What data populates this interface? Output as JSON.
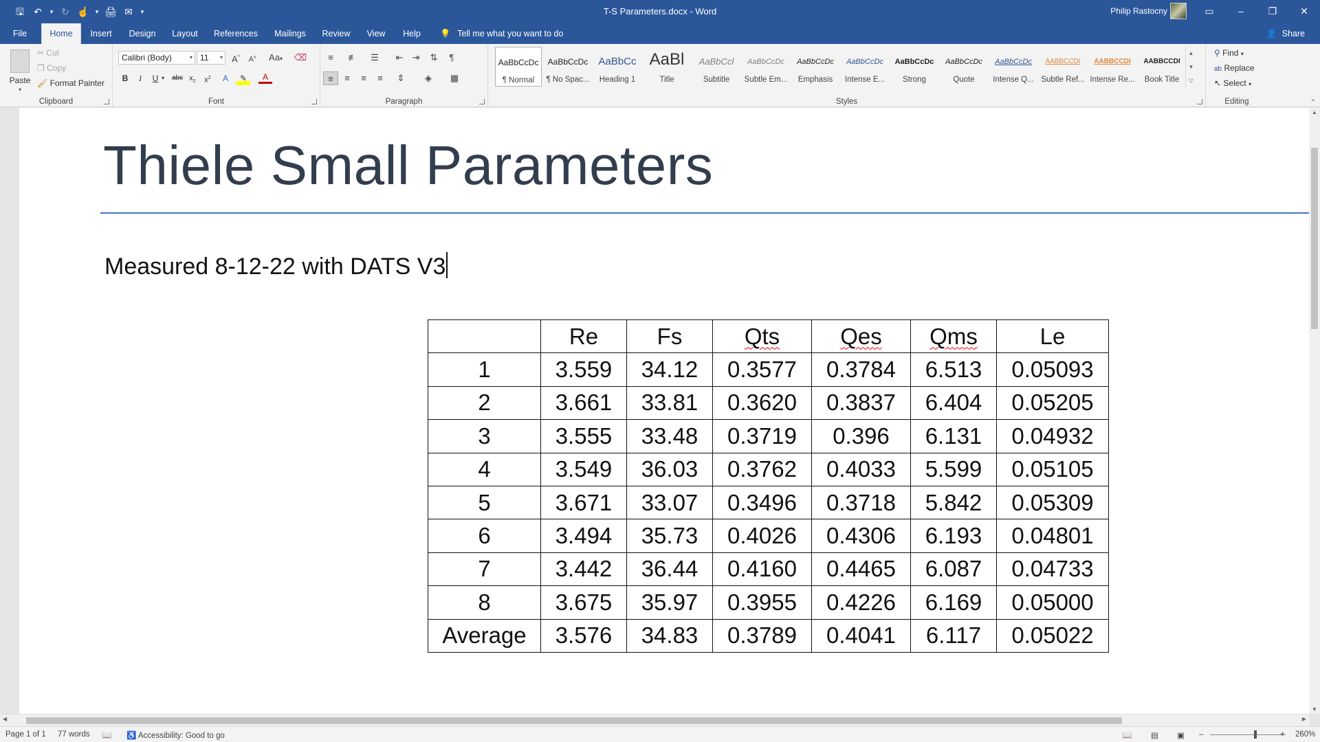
{
  "window": {
    "title": "T-S Parameters.docx  -  Word",
    "user_name": "Philip Rastocny",
    "controls": {
      "ribbon_display": "▭",
      "minimize": "–",
      "restore": "❐",
      "close": "✕"
    }
  },
  "quick_access": [
    "save-icon",
    "undo-icon",
    "redo-icon",
    "touch-mode-icon",
    "print-preview-icon",
    "email-icon",
    "customize-icon"
  ],
  "tabs": [
    "File",
    "Home",
    "Insert",
    "Design",
    "Layout",
    "References",
    "Mailings",
    "Review",
    "View",
    "Help"
  ],
  "active_tab": "Home",
  "tell_me": "Tell me what you want to do",
  "share": "Share",
  "ribbon": {
    "clipboard": {
      "label": "Clipboard",
      "paste": "Paste",
      "cut": "Cut",
      "copy": "Copy",
      "format_painter": "Format Painter"
    },
    "font": {
      "label": "Font",
      "font_name": "Calibri (Body)",
      "font_size": "11"
    },
    "paragraph": {
      "label": "Paragraph"
    },
    "styles": {
      "label": "Styles",
      "items": [
        {
          "preview": "AaBbCcDc",
          "name": "¶ Normal"
        },
        {
          "preview": "AaBbCcDc",
          "name": "¶ No Spac..."
        },
        {
          "preview": "AaBbCc",
          "name": "Heading 1"
        },
        {
          "preview": "AaBl",
          "name": "Title"
        },
        {
          "preview": "AaBbCcl",
          "name": "Subtitle"
        },
        {
          "preview": "AaBbCcDc",
          "name": "Subtle Em..."
        },
        {
          "preview": "AaBbCcDc",
          "name": "Emphasis"
        },
        {
          "preview": "AaBbCcDc",
          "name": "Intense E..."
        },
        {
          "preview": "AaBbCcDc",
          "name": "Strong"
        },
        {
          "preview": "AaBbCcDc",
          "name": "Quote"
        },
        {
          "preview": "AaBbCcDc",
          "name": "Intense Q..."
        },
        {
          "preview": "AABBCCDI",
          "name": "Subtle Ref..."
        },
        {
          "preview": "AABBCCDI",
          "name": "Intense Re..."
        },
        {
          "preview": "AABBCCDI",
          "name": "Book Title"
        }
      ]
    },
    "editing": {
      "label": "Editing",
      "find": "Find",
      "replace": "Replace",
      "select": "Select"
    }
  },
  "document": {
    "heading": "Thiele Small Parameters",
    "subtitle": "Measured 8-12-22 with DATS V3",
    "table": {
      "headers": [
        "",
        "Re",
        "Fs",
        "Qts",
        "Qes",
        "Qms",
        "Le"
      ],
      "rows": [
        [
          "1",
          "3.559",
          "34.12",
          "0.3577",
          "0.3784",
          "6.513",
          "0.05093"
        ],
        [
          "2",
          "3.661",
          "33.81",
          "0.3620",
          "0.3837",
          "6.404",
          "0.05205"
        ],
        [
          "3",
          "3.555",
          "33.48",
          "0.3719",
          "0.396",
          "6.131",
          "0.04932"
        ],
        [
          "4",
          "3.549",
          "36.03",
          "0.3762",
          "0.4033",
          "5.599",
          "0.05105"
        ],
        [
          "5",
          "3.671",
          "33.07",
          "0.3496",
          "0.3718",
          "5.842",
          "0.05309"
        ],
        [
          "6",
          "3.494",
          "35.73",
          "0.4026",
          "0.4306",
          "6.193",
          "0.04801"
        ],
        [
          "7",
          "3.442",
          "36.44",
          "0.4160",
          "0.4465",
          "6.087",
          "0.04733"
        ],
        [
          "8",
          "3.675",
          "35.97",
          "0.3955",
          "0.4226",
          "6.169",
          "0.05000"
        ],
        [
          "Average",
          "3.576",
          "34.83",
          "0.3789",
          "0.4041",
          "6.117",
          "0.05022"
        ]
      ]
    }
  },
  "status": {
    "page": "Page 1 of 1",
    "words": "77 words",
    "accessibility": "Accessibility: Good to go",
    "zoom": "260%"
  },
  "colors": {
    "title_bar": "#2b579a",
    "ribbon": "#f3f3f3",
    "heading_text": "#323d4e",
    "heading_rule": "#4472c4"
  }
}
